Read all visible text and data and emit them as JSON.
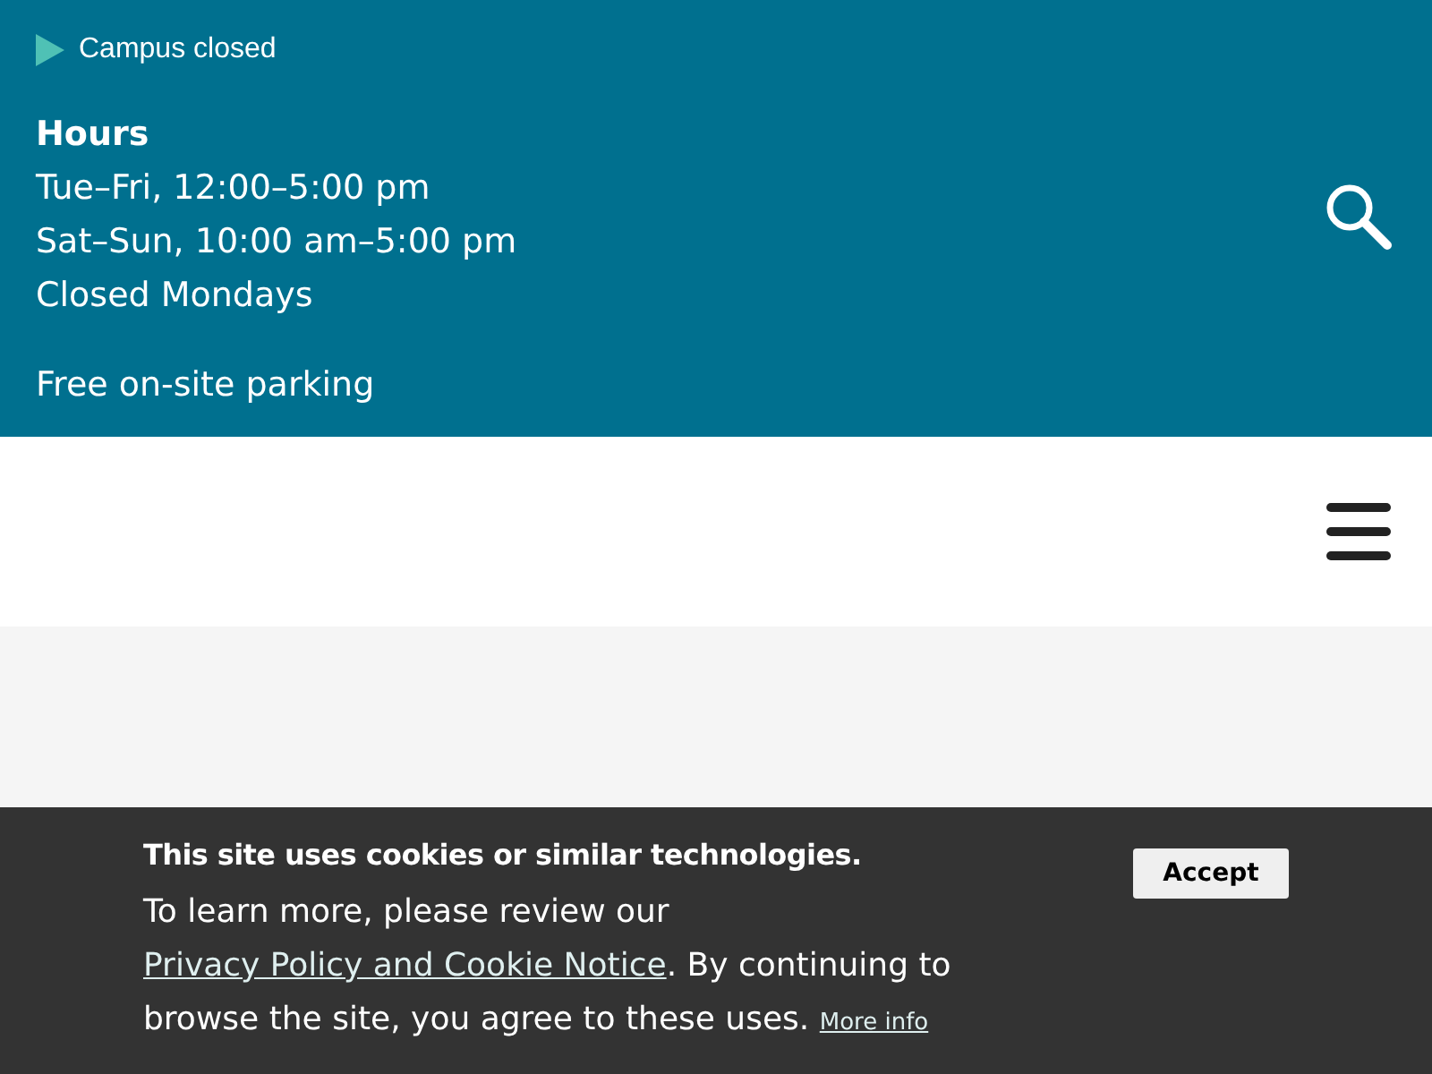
{
  "alert": {
    "text": "Campus closed"
  },
  "hours": {
    "heading": "Hours",
    "lines": [
      "Tue–Fri, 12:00–5:00 pm",
      "Sat–Sun, 10:00 am–5:00 pm",
      "Closed Mondays"
    ],
    "parking": "Free on-site parking"
  },
  "cookie_banner": {
    "title": "This site uses cookies or similar technologies.",
    "body": [
      {
        "kind": "text",
        "text": "To learn more, please review our "
      },
      {
        "kind": "link",
        "text": "Privacy Policy and Cookie Notice"
      },
      {
        "kind": "text",
        "text": ". By continuing to browse the site, you agree to these uses. "
      },
      {
        "kind": "small_link",
        "text": "More info"
      }
    ],
    "button": "Accept"
  }
}
